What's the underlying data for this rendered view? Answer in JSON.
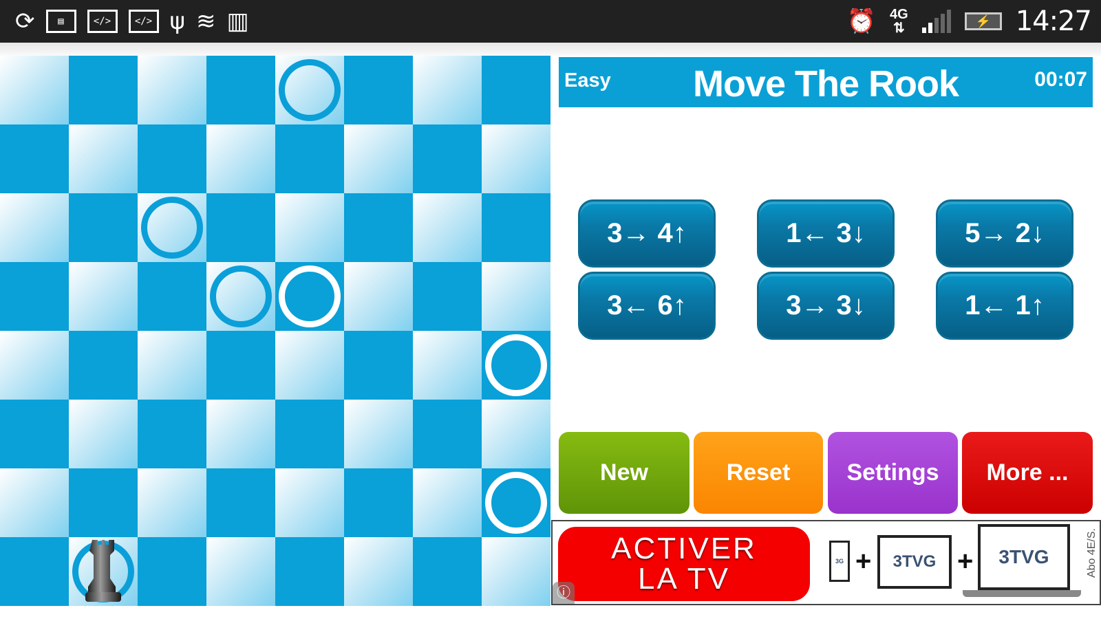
{
  "status_bar": {
    "left_icons": [
      "sync-icon",
      "image-icon",
      "code-icon",
      "code-icon",
      "usb-icon",
      "wifi-icon",
      "barcode-icon"
    ],
    "right_icons": [
      "alarm-icon",
      "network-4g-icon",
      "signal-icon",
      "battery-charging-icon"
    ],
    "network_label": "4G",
    "time": "14:27"
  },
  "board": {
    "size": 8,
    "light_color": "#c6e9f7",
    "dark_color": "#0aa0d8",
    "targets": [
      [
        0,
        4
      ],
      [
        2,
        2
      ],
      [
        3,
        3
      ],
      [
        3,
        4
      ],
      [
        4,
        7
      ],
      [
        6,
        7
      ]
    ],
    "rook": [
      7,
      1
    ]
  },
  "header": {
    "difficulty": "Easy",
    "title": "Move The Rook",
    "timer": "00:07",
    "color": "#0aa0d6"
  },
  "moves": [
    "3→ 4↑",
    "1← 3↓",
    "5→ 2↓",
    "3← 6↑",
    "3→ 3↓",
    "1← 1↑"
  ],
  "actions": {
    "new": {
      "label": "New",
      "color": "#6fa010"
    },
    "reset": {
      "label": "Reset",
      "color": "#fb8c00"
    },
    "settings": {
      "label": "Settings",
      "color": "#a23fd2"
    },
    "more": {
      "label": "More ...",
      "color": "#d60000"
    }
  },
  "ad": {
    "headline_1": "ACTIVER",
    "headline_2": "LA TV",
    "brand_small": "3G",
    "brand": "3TVG",
    "side_text": "Abo 4E/S."
  }
}
